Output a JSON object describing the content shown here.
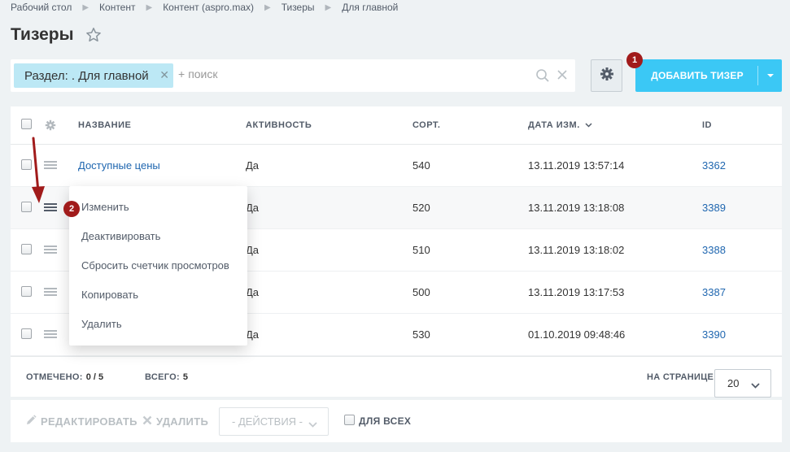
{
  "breadcrumb": [
    "Рабочий стол",
    "Контент",
    "Контент (aspro.max)",
    "Тизеры",
    "Для главной"
  ],
  "page": {
    "title": "Тизеры"
  },
  "filter": {
    "chip_label": "Раздел: . Для главной",
    "search_placeholder": "поиск",
    "plus": "+"
  },
  "toolbar": {
    "add_button_label": "ДОБАВИТЬ ТИЗЕР"
  },
  "markers": [
    "1",
    "2"
  ],
  "table": {
    "columns": [
      "НАЗВАНИЕ",
      "АКТИВНОСТЬ",
      "СОРТ.",
      "ДАТА ИЗМ.",
      "ID"
    ],
    "rows": [
      {
        "name": "Доступные цены",
        "active": "Да",
        "sort": "540",
        "date": "13.11.2019 13:57:14",
        "id": "3362"
      },
      {
        "name": "",
        "active": "Да",
        "sort": "520",
        "date": "13.11.2019 13:18:08",
        "id": "3389"
      },
      {
        "name": "",
        "active": "Да",
        "sort": "510",
        "date": "13.11.2019 13:18:02",
        "id": "3388"
      },
      {
        "name": "",
        "active": "Да",
        "sort": "500",
        "date": "13.11.2019 13:17:53",
        "id": "3387"
      },
      {
        "name": "",
        "active": "Да",
        "sort": "530",
        "date": "01.10.2019 09:48:46",
        "id": "3390"
      }
    ]
  },
  "context_menu": [
    "Изменить",
    "Деактивировать",
    "Сбросить счетчик просмотров",
    "Копировать",
    "Удалить"
  ],
  "footer": {
    "marked_label": "ОТМЕЧЕНО:",
    "marked_value": "0 / 5",
    "total_label": "ВСЕГО:",
    "total_value": "5",
    "per_page_label": "НА СТРАНИЦЕ:",
    "per_page_value": "20"
  },
  "actions": {
    "edit_label": "РЕДАКТИРОВАТЬ",
    "delete_label": "УДАЛИТЬ",
    "actions_select": "- ДЕЙСТВИЯ -",
    "for_all_label": "ДЛЯ ВСЕХ"
  },
  "colors": {
    "accent": "#3bc8f5",
    "marker": "#a11b1b",
    "link": "#2067b0",
    "chip": "#bce8f5"
  }
}
